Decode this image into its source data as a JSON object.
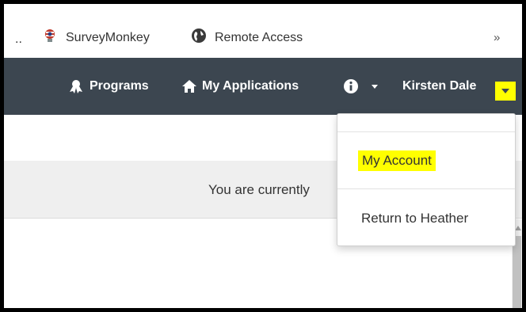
{
  "bookmarks": {
    "ellipsis": "..",
    "items": [
      {
        "label": "SurveyMonkey",
        "icon": "surveymonkey-logo-icon"
      },
      {
        "label": "Remote Access",
        "icon": "globe-icon"
      }
    ],
    "more": "»"
  },
  "navbar": {
    "programs_label": "Programs",
    "applications_label": "My Applications",
    "user_name": "Kirsten Dale",
    "background_color": "#3c4650",
    "highlight_color": "#ffff00"
  },
  "notice": {
    "text": "You are currently"
  },
  "user_menu": {
    "items": [
      "My Account",
      "Return to Heather"
    ]
  }
}
